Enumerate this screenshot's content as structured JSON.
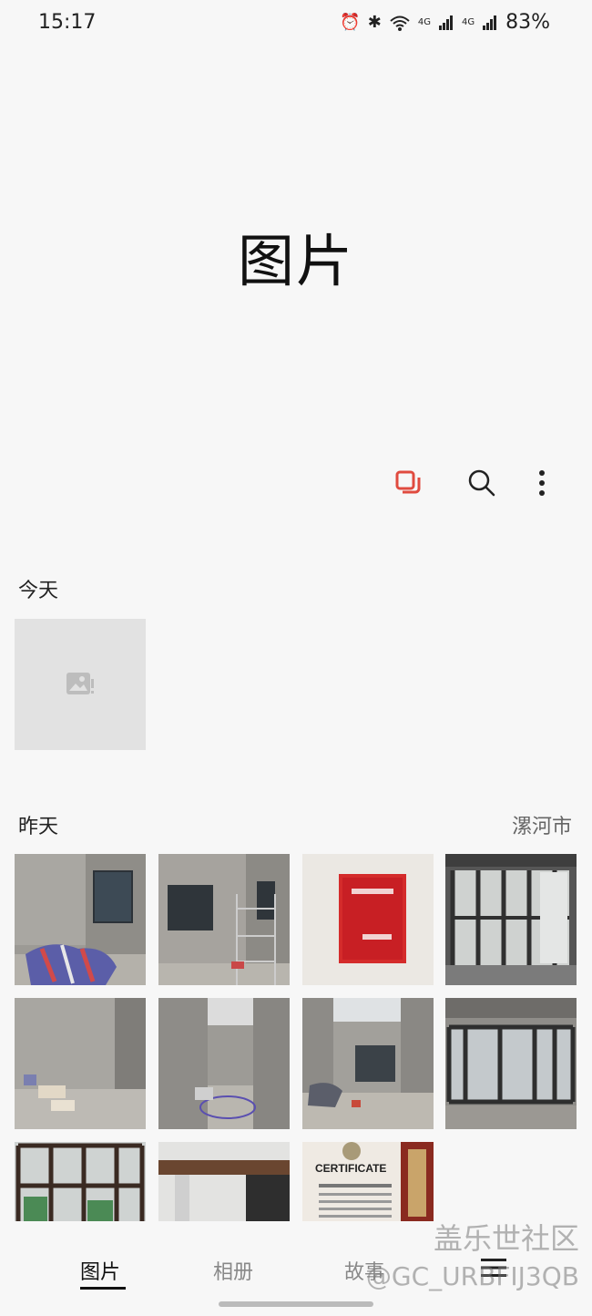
{
  "status_bar": {
    "time": "15:17",
    "battery": "83%",
    "net_label_1": "4G",
    "net_label_2": "4G"
  },
  "header": {
    "title": "图片"
  },
  "toolbar": {
    "select_icon": "select-multiple-icon",
    "search_icon": "search-icon",
    "more_icon": "more-vert-icon",
    "accent_color": "#e04b3f"
  },
  "sections": [
    {
      "title": "今天",
      "location": ""
    },
    {
      "title": "昨天",
      "location": "漯河市"
    }
  ],
  "bottom_nav": {
    "tabs": [
      "图片",
      "相册",
      "故事"
    ],
    "active": "图片"
  },
  "watermark": {
    "line1": "盖乐世社区",
    "line2": "@GC_URBFIJ3QB"
  },
  "photo_poster": {
    "heading": "CERTIFICATE"
  }
}
